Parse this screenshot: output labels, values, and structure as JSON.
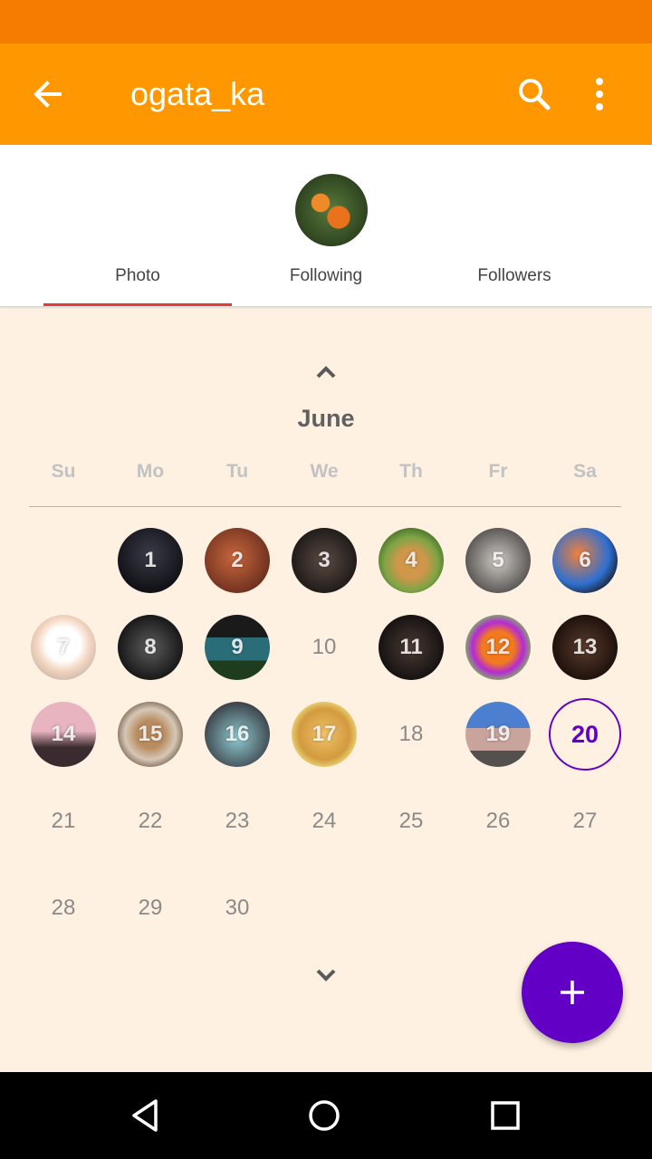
{
  "app_bar": {
    "title": "ogata_ka",
    "color": "#ff9800"
  },
  "profile": {
    "tabs": [
      {
        "label": "Photo",
        "selected": true
      },
      {
        "label": "Following",
        "selected": false
      },
      {
        "label": "Followers",
        "selected": false
      }
    ]
  },
  "calendar": {
    "month": "June",
    "weekdays": [
      "Su",
      "Mo",
      "Tu",
      "We",
      "Th",
      "Fr",
      "Sa"
    ],
    "weeks": [
      [
        null,
        {
          "d": "1",
          "photo": true
        },
        {
          "d": "2",
          "photo": true
        },
        {
          "d": "3",
          "photo": true
        },
        {
          "d": "4",
          "photo": true
        },
        {
          "d": "5",
          "photo": true
        },
        {
          "d": "6",
          "photo": true
        }
      ],
      [
        {
          "d": "7",
          "photo": true
        },
        {
          "d": "8",
          "photo": true
        },
        {
          "d": "9",
          "photo": true
        },
        {
          "d": "10"
        },
        {
          "d": "11",
          "photo": true
        },
        {
          "d": "12",
          "photo": true
        },
        {
          "d": "13",
          "photo": true
        }
      ],
      [
        {
          "d": "14",
          "photo": true
        },
        {
          "d": "15",
          "photo": true
        },
        {
          "d": "16",
          "photo": true
        },
        {
          "d": "17",
          "photo": true
        },
        {
          "d": "18"
        },
        {
          "d": "19",
          "photo": true
        },
        {
          "d": "20",
          "today": true
        }
      ],
      [
        {
          "d": "21"
        },
        {
          "d": "22"
        },
        {
          "d": "23"
        },
        {
          "d": "24"
        },
        {
          "d": "25"
        },
        {
          "d": "26"
        },
        {
          "d": "27"
        }
      ],
      [
        {
          "d": "28"
        },
        {
          "d": "29"
        },
        {
          "d": "30"
        },
        null,
        null,
        null,
        null
      ]
    ],
    "accent": "#6200c6"
  },
  "icons": {
    "back": "arrow-left-icon",
    "search": "search-icon",
    "more": "more-vert-icon",
    "prev_month": "chevron-up-icon",
    "next_month": "chevron-down-icon",
    "fab": "plus-icon"
  }
}
